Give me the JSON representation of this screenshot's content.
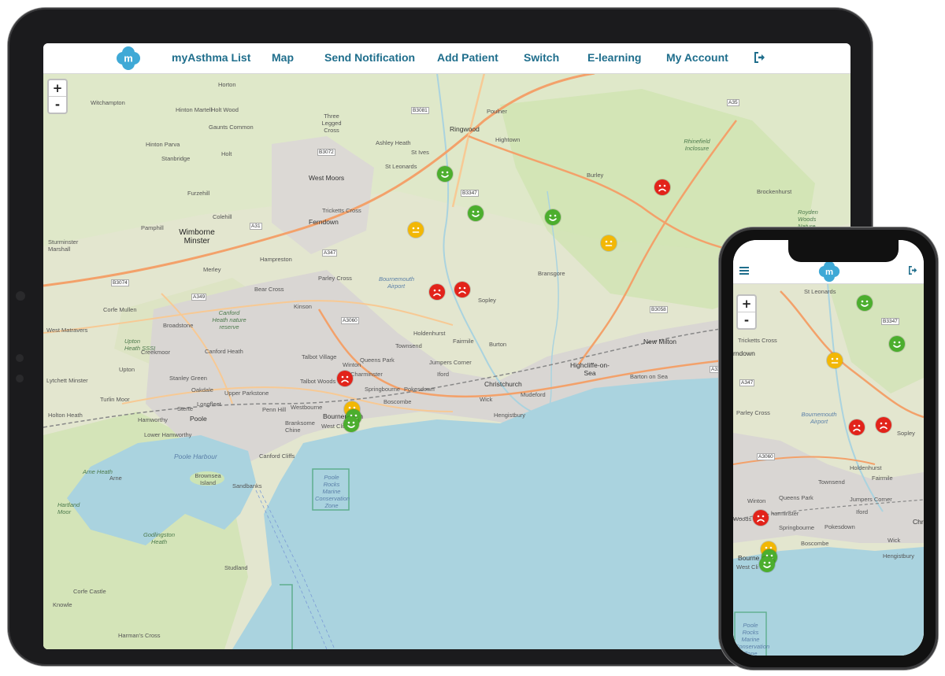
{
  "nav": {
    "items": [
      {
        "label": "myAsthma List"
      },
      {
        "label": "Map"
      },
      {
        "label": "Send Notification"
      },
      {
        "label": "Add Patient"
      },
      {
        "label": "Switch"
      },
      {
        "label": "E-learning"
      },
      {
        "label": "My Account"
      }
    ],
    "logo_letter": "m",
    "logout_icon": "logout-icon",
    "menu_icon": "hamburger-menu-icon"
  },
  "zoom": {
    "in_label": "+",
    "out_label": "-"
  },
  "colors": {
    "brand": "#2f7fa5",
    "logo": "#3fa9d6",
    "good": "#4cae2e",
    "moderate": "#f2b705",
    "poor": "#e2231a",
    "sea": "#aad3df",
    "land": "#e3e6cf"
  },
  "map": {
    "labels": [
      {
        "text": "Horton"
      },
      {
        "text": "Witchampton"
      },
      {
        "text": "Hinton Martell"
      },
      {
        "text": "Holt Wood"
      },
      {
        "text": "Gaunts Common"
      },
      {
        "text": "Hinton Parva"
      },
      {
        "text": "Stanbridge"
      },
      {
        "text": "Holt"
      },
      {
        "text": "Furzehill"
      },
      {
        "text": "Colehill"
      },
      {
        "text": "Pamphill"
      },
      {
        "text": "Wimborne Minster"
      },
      {
        "text": "Sturminster Marshall"
      },
      {
        "text": "Merley"
      },
      {
        "text": "Three Legged Cross"
      },
      {
        "text": "Ashley Heath"
      },
      {
        "text": "St Ives"
      },
      {
        "text": "St Leonards"
      },
      {
        "text": "Ringwood"
      },
      {
        "text": "Poulner"
      },
      {
        "text": "Hightown"
      },
      {
        "text": "West Moors"
      },
      {
        "text": "Tricketts Cross"
      },
      {
        "text": "Ferndown"
      },
      {
        "text": "Hampreston"
      },
      {
        "text": "Burley"
      },
      {
        "text": "Rhinefield Inclosure"
      },
      {
        "text": "Brockenhurst"
      },
      {
        "text": "Royden Woods Nature Reserve"
      },
      {
        "text": "Parley Cross"
      },
      {
        "text": "Bournemouth Airport"
      },
      {
        "text": "Bransgore"
      },
      {
        "text": "Sopley"
      },
      {
        "text": "Bear Cross"
      },
      {
        "text": "Kinson"
      },
      {
        "text": "Corfe Mullen"
      },
      {
        "text": "Broadstone"
      },
      {
        "text": "Canford Heath nature reserve"
      },
      {
        "text": "West Matravers"
      },
      {
        "text": "Upton Heath SSSI"
      },
      {
        "text": "Creekmoor"
      },
      {
        "text": "Canford Heath"
      },
      {
        "text": "Holdenhurst"
      },
      {
        "text": "Fairmile"
      },
      {
        "text": "Burton"
      },
      {
        "text": "New Milton"
      },
      {
        "text": "Talbot Village"
      },
      {
        "text": "Queens Park"
      },
      {
        "text": "Townsend"
      },
      {
        "text": "Winton"
      },
      {
        "text": "Talbot Woods"
      },
      {
        "text": "Charminster"
      },
      {
        "text": "Jumpers Corner"
      },
      {
        "text": "Iford"
      },
      {
        "text": "Christchurch"
      },
      {
        "text": "Highcliffe-on-Sea"
      },
      {
        "text": "Barton on Sea"
      },
      {
        "text": "Upton"
      },
      {
        "text": "Lytchett Minster"
      },
      {
        "text": "Stanley Green"
      },
      {
        "text": "Oakdale"
      },
      {
        "text": "Upper Parkstone"
      },
      {
        "text": "Springbourne"
      },
      {
        "text": "Pokesdown"
      },
      {
        "text": "Boscombe"
      },
      {
        "text": "Wick"
      },
      {
        "text": "Mudeford"
      },
      {
        "text": "Turlin Moor"
      },
      {
        "text": "Sterte"
      },
      {
        "text": "Longfleet"
      },
      {
        "text": "Penn Hill"
      },
      {
        "text": "Westbourne"
      },
      {
        "text": "Bournemouth"
      },
      {
        "text": "West Cliff"
      },
      {
        "text": "Hengistbury"
      },
      {
        "text": "Holton Heath"
      },
      {
        "text": "Hamworthy"
      },
      {
        "text": "Poole"
      },
      {
        "text": "Lower Hamworthy"
      },
      {
        "text": "Branksome Chine"
      },
      {
        "text": "Canford Cliffs"
      },
      {
        "text": "Poole Harbour"
      },
      {
        "text": "Arne Heath"
      },
      {
        "text": "Arne"
      },
      {
        "text": "Brownsea Island"
      },
      {
        "text": "Sandbanks"
      },
      {
        "text": "Poole Rocks Marine Conservation Zone"
      },
      {
        "text": "Hartland Moor"
      },
      {
        "text": "Godlingston Heath"
      },
      {
        "text": "Studland"
      },
      {
        "text": "Corfe Castle"
      },
      {
        "text": "Knowle"
      },
      {
        "text": "Harman's Cross"
      }
    ],
    "roads": [
      "B3081",
      "B3072",
      "A35",
      "B3347",
      "A31",
      "A347",
      "B3074",
      "A349",
      "A3060",
      "B3058",
      "A337"
    ]
  },
  "phone_map": {
    "labels": [
      "St Leonards",
      "B3347",
      "Tricketts Cross",
      "rndown",
      "A347",
      "Parley Cross",
      "Bournemouth Airport",
      "Sopley",
      "A3060",
      "Holdenhurst",
      "Fairmile",
      "Townsend",
      "Winton",
      "Queens Park",
      "Jumpers Corner",
      "Woods",
      "harminster",
      "Iford",
      "Christ",
      "Springbourne",
      "Pokesdown",
      "Boscombe",
      "Wick",
      "Bourne",
      "Hengistbury",
      "West Cli",
      "Poole Rocks Marine Conservation Zone"
    ]
  },
  "patients": [
    {
      "status": "good"
    },
    {
      "status": "good"
    },
    {
      "status": "good"
    },
    {
      "status": "poor"
    },
    {
      "status": "moderate"
    },
    {
      "status": "moderate"
    },
    {
      "status": "poor"
    },
    {
      "status": "poor"
    },
    {
      "status": "poor"
    },
    {
      "status": "moderate"
    },
    {
      "status": "good"
    },
    {
      "status": "good"
    }
  ]
}
